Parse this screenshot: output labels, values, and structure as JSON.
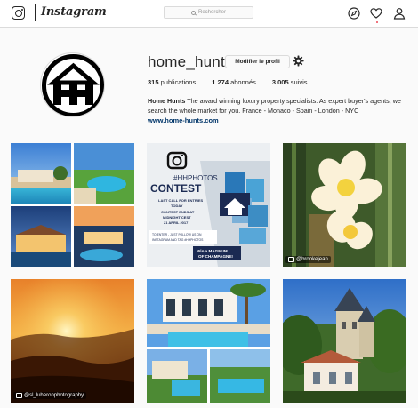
{
  "topbar": {
    "wordmark": "Instagram",
    "search_placeholder": "Rechercher",
    "icons": [
      "instagram-camera-icon",
      "explore-compass-icon",
      "heart-icon",
      "profile-person-icon"
    ]
  },
  "profile": {
    "username": "home_hunts",
    "edit_label": "Modifier le profil",
    "posts_count": "315",
    "posts_label": "publications",
    "followers_count": "1 274",
    "followers_label": "abonnés",
    "following_count": "3 005",
    "following_label": "suivis",
    "bio_name": "Home Hunts",
    "bio_text": " The award winning luxury property specialists. As expert buyer's agents, we search the whole market for you. France - Monaco - Spain - London - NYC",
    "website": "www.home-hunts.com"
  },
  "posts": {
    "contest": {
      "hash": "#HHPHOTOS",
      "title": "CONTEST",
      "line1": "LAST CALL FOR ENTRIES",
      "line2": "TODAY",
      "line3": "CONTEST ENDS AT",
      "line4": "MIDNIGHT CEST",
      "line5": "21 APRIL 2017",
      "rules1": "TO ENTER - JUST FOLLOW US ON",
      "rules2": "INSTAGRAM AND TAG #HHPHOTOS",
      "prize1": "Win a MAGNUM",
      "prize2": "OF CHAMPAGNE!"
    },
    "credit_flower": "@brookejean",
    "credit_sunset": "@sl_luberonphotography"
  },
  "colors": {
    "link": "#003569",
    "border": "#dbdbdb",
    "background": "#fafafa"
  }
}
